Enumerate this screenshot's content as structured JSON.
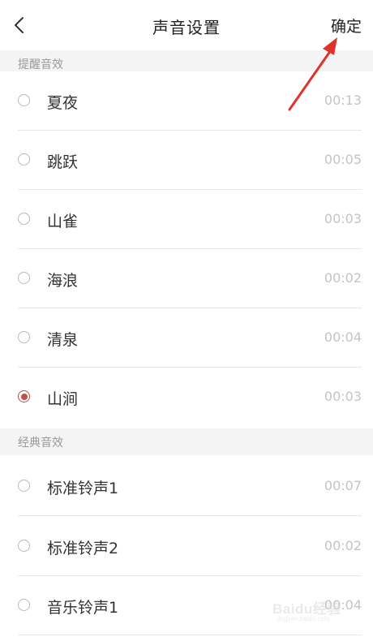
{
  "header": {
    "title": "声音设置",
    "confirm_label": "确定"
  },
  "sections": [
    {
      "title": "提醒音效",
      "items": [
        {
          "name": "夏夜",
          "duration": "00:13",
          "selected": false
        },
        {
          "name": "跳跃",
          "duration": "00:05",
          "selected": false
        },
        {
          "name": "山雀",
          "duration": "00:03",
          "selected": false
        },
        {
          "name": "海浪",
          "duration": "00:02",
          "selected": false
        },
        {
          "name": "清泉",
          "duration": "00:04",
          "selected": false
        },
        {
          "name": "山涧",
          "duration": "00:03",
          "selected": true
        }
      ]
    },
    {
      "title": "经典音效",
      "items": [
        {
          "name": "标准铃声1",
          "duration": "00:07",
          "selected": false
        },
        {
          "name": "标准铃声2",
          "duration": "00:02",
          "selected": false
        },
        {
          "name": "音乐铃声1",
          "duration": "00:04",
          "selected": false
        }
      ]
    }
  ],
  "watermark": {
    "main": "Baidu经验",
    "sub": "jingyan.baidu.com"
  },
  "colors": {
    "accent": "#c0504d",
    "annotation_arrow": "#e0322c",
    "section_bg": "#f4f4f4",
    "muted_text": "#c4c4c4"
  },
  "icons": {
    "back": "chevron-left-icon",
    "radio_on": "radio-checked-icon",
    "radio_off": "radio-unchecked-icon"
  }
}
